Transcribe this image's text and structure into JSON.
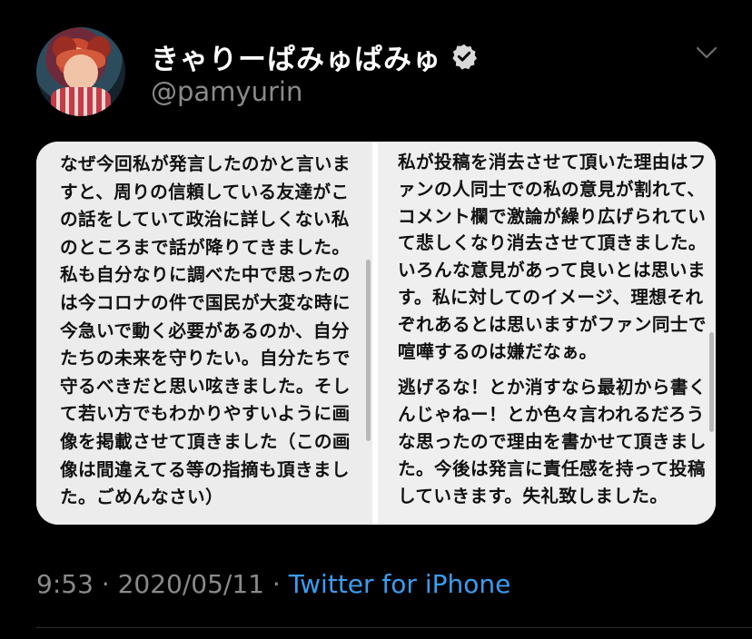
{
  "tweet": {
    "display_name": "きゃりーぱみゅぱみゅ",
    "handle": "@pamyurin",
    "verified": true,
    "avatar_icon": "profile-photo",
    "menu_icon": "chevron-down-icon",
    "timestamp": "9:53",
    "separator1": " · ",
    "date": "2020/05/11",
    "separator2": " · ",
    "source": "Twitter for iPhone",
    "colors": {
      "background": "#000000",
      "text": "#ffffff",
      "secondary": "#8a8a8a",
      "link": "#3b9cf0",
      "verified_badge": "#d9d9d9"
    }
  },
  "media": {
    "left_text": "なぜ今回私が発言したのかと言いますと、周りの信頼している友達がこの話をしていて政治に詳しくない私のところまで話が降りてきました。私も自分なりに調べた中で思ったのは今コロナの件で国民が大変な時に今急いで動く必要があるのか、自分たちの未来を守りたい。自分たちで守るべきだと思い呟きました。そして若い方でもわかりやすいように画像を掲載させて頂きました（この画像は間違えてる等の指摘も頂きました。ごめんなさい）",
    "right_text_1": "私が投稿を消去させて頂いた理由はファンの人同士での私の意見が割れて、コメント欄で激論が繰り広げられていて悲しくなり消去させて頂きました。いろんな意見があって良いとは思います。私に対してのイメージ、理想それぞれあるとは思いますがファン同士で喧嘩するのは嫌だなぁ。",
    "right_text_2": "逃げるな！とか消すなら最初から書くんじゃねー！とか色々言われるだろうな思ったので理由を書かせて頂きました。今後は発言に責任感を持って投稿していきます。失礼致しました。"
  }
}
